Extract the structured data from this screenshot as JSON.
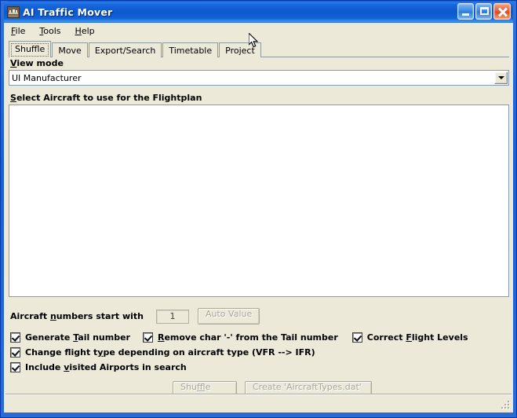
{
  "window": {
    "title": "AI Traffic Mover",
    "icon": "app-icon",
    "buttons": {
      "minimize": "minimize-icon",
      "maximize": "maximize-icon",
      "close": "close-icon"
    }
  },
  "menubar": {
    "items": [
      {
        "label": "File",
        "mnemonic": "F"
      },
      {
        "label": "Tools",
        "mnemonic": "T"
      },
      {
        "label": "Help",
        "mnemonic": "H"
      }
    ]
  },
  "tabs": {
    "active": "Shuffle",
    "items": [
      {
        "label": "Shuffle"
      },
      {
        "label": "Move"
      },
      {
        "label": "Export/Search"
      },
      {
        "label": "Timetable"
      },
      {
        "label": "Project"
      }
    ]
  },
  "main": {
    "view_mode": {
      "label_pre": "V",
      "label_mn": "",
      "label": "View mode",
      "value": "UI Manufacturer",
      "arrow_icon": "chevron-down-icon"
    },
    "aircraft_list": {
      "label": "Select Aircraft to use for the Flightplan",
      "items": []
    },
    "numbers_row": {
      "label": "Aircraft numbers start with",
      "value": "1",
      "auto_value_label": "Auto Value",
      "auto_value_disabled": true
    },
    "checkboxes": [
      {
        "label": "Generate Tail number",
        "checked": true
      },
      {
        "label": "Remove char '-' from the Tail number",
        "checked": true
      },
      {
        "label": "Correct Flight Levels",
        "checked": true
      },
      {
        "label": "Change flight type depending on aircraft type (VFR --> IFR)",
        "checked": true
      },
      {
        "label": "Include visited Airports in search",
        "checked": true
      }
    ],
    "actions": {
      "shuffle_label": "Shuffle",
      "shuffle_disabled": true,
      "create_label": "Create 'AircraftTypes.dat'",
      "create_disabled": true
    }
  },
  "statusbar": {
    "text": "",
    "grip_icon": "resize-grip-icon"
  },
  "colors": {
    "titlebar": "#0b58cf",
    "client": "#ece9d8",
    "frame": "#1a5fd0",
    "close_button": "#d94c22"
  }
}
